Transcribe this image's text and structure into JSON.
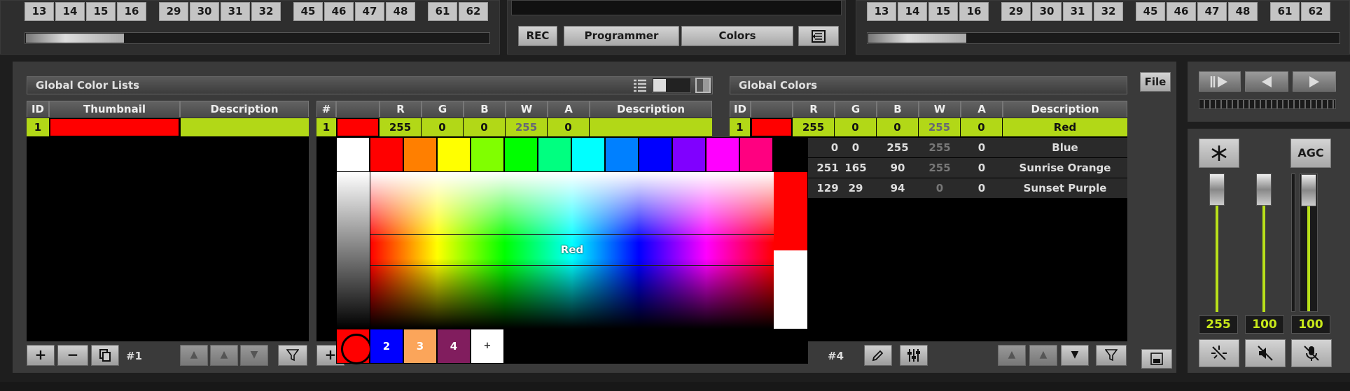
{
  "top_left_numbers": [
    "13",
    "14",
    "15",
    "16",
    "29",
    "30",
    "31",
    "32",
    "45",
    "46",
    "47",
    "48",
    "61",
    "62"
  ],
  "top_right_numbers": [
    "13",
    "14",
    "15",
    "16",
    "29",
    "30",
    "31",
    "32",
    "45",
    "46",
    "47",
    "48",
    "61",
    "62"
  ],
  "toolbar": {
    "rec_label": "REC",
    "programmer_label": "Programmer",
    "colors_label": "Colors"
  },
  "file_label": "File",
  "color_lists": {
    "title": "Global Color Lists",
    "headers": [
      "ID",
      "Thumbnail",
      "Description"
    ],
    "rows": [
      {
        "id": "1",
        "thumb_color": "#ff0000",
        "description": ""
      }
    ],
    "count_label": "#1"
  },
  "list_entries": {
    "headers": [
      "#",
      "",
      "R",
      "G",
      "B",
      "W",
      "A",
      "Description"
    ],
    "rows": [
      {
        "n": "1",
        "color": "#ff0000",
        "r": "255",
        "g": "0",
        "b": "0",
        "w": "255",
        "a": "0",
        "description": ""
      }
    ]
  },
  "global_colors": {
    "title": "Global Colors",
    "headers": [
      "ID",
      "",
      "R",
      "G",
      "B",
      "W",
      "A",
      "Description"
    ],
    "rows": [
      {
        "id": "1",
        "color": "#ff0000",
        "r": "255",
        "g": "0",
        "b": "0",
        "w": "255",
        "a": "0",
        "description": "Red"
      },
      {
        "id": "",
        "color": "",
        "r": "0",
        "g": "0",
        "b": "255",
        "w": "255",
        "a": "0",
        "description": "Blue"
      },
      {
        "id": "",
        "color": "",
        "r": "251",
        "g": "165",
        "b": "90",
        "w": "255",
        "a": "0",
        "description": "Sunrise Orange"
      },
      {
        "id": "",
        "color": "",
        "r": "129",
        "g": "29",
        "b": "94",
        "w": "0",
        "a": "0",
        "description": "Sunset Purple"
      }
    ],
    "count_label": "#4"
  },
  "picker": {
    "swatches": [
      "#ffffff",
      "#ff0000",
      "#ff7f00",
      "#ffff00",
      "#80ff00",
      "#00ff00",
      "#00ff80",
      "#00ffff",
      "#0080ff",
      "#0000ff",
      "#8000ff",
      "#ff00ff",
      "#ff0080",
      "#000000"
    ],
    "selected_label": "Red",
    "current_color": "#ff0000",
    "history": [
      {
        "label": "",
        "color": "#ff0000"
      },
      {
        "label": "2",
        "color": "#0000ff"
      },
      {
        "label": "3",
        "color": "#fba55a"
      },
      {
        "label": "4",
        "color": "#811d5e"
      },
      {
        "label": "+",
        "color": "#ffffff"
      }
    ]
  },
  "master": {
    "agc_label": "AGC",
    "fader_values": [
      "255",
      "100",
      "100"
    ],
    "fader_levels": [
      1.0,
      1.0,
      1.0
    ]
  },
  "colors": {
    "accent": "#b2d817",
    "selected_row": "#b2d817"
  }
}
